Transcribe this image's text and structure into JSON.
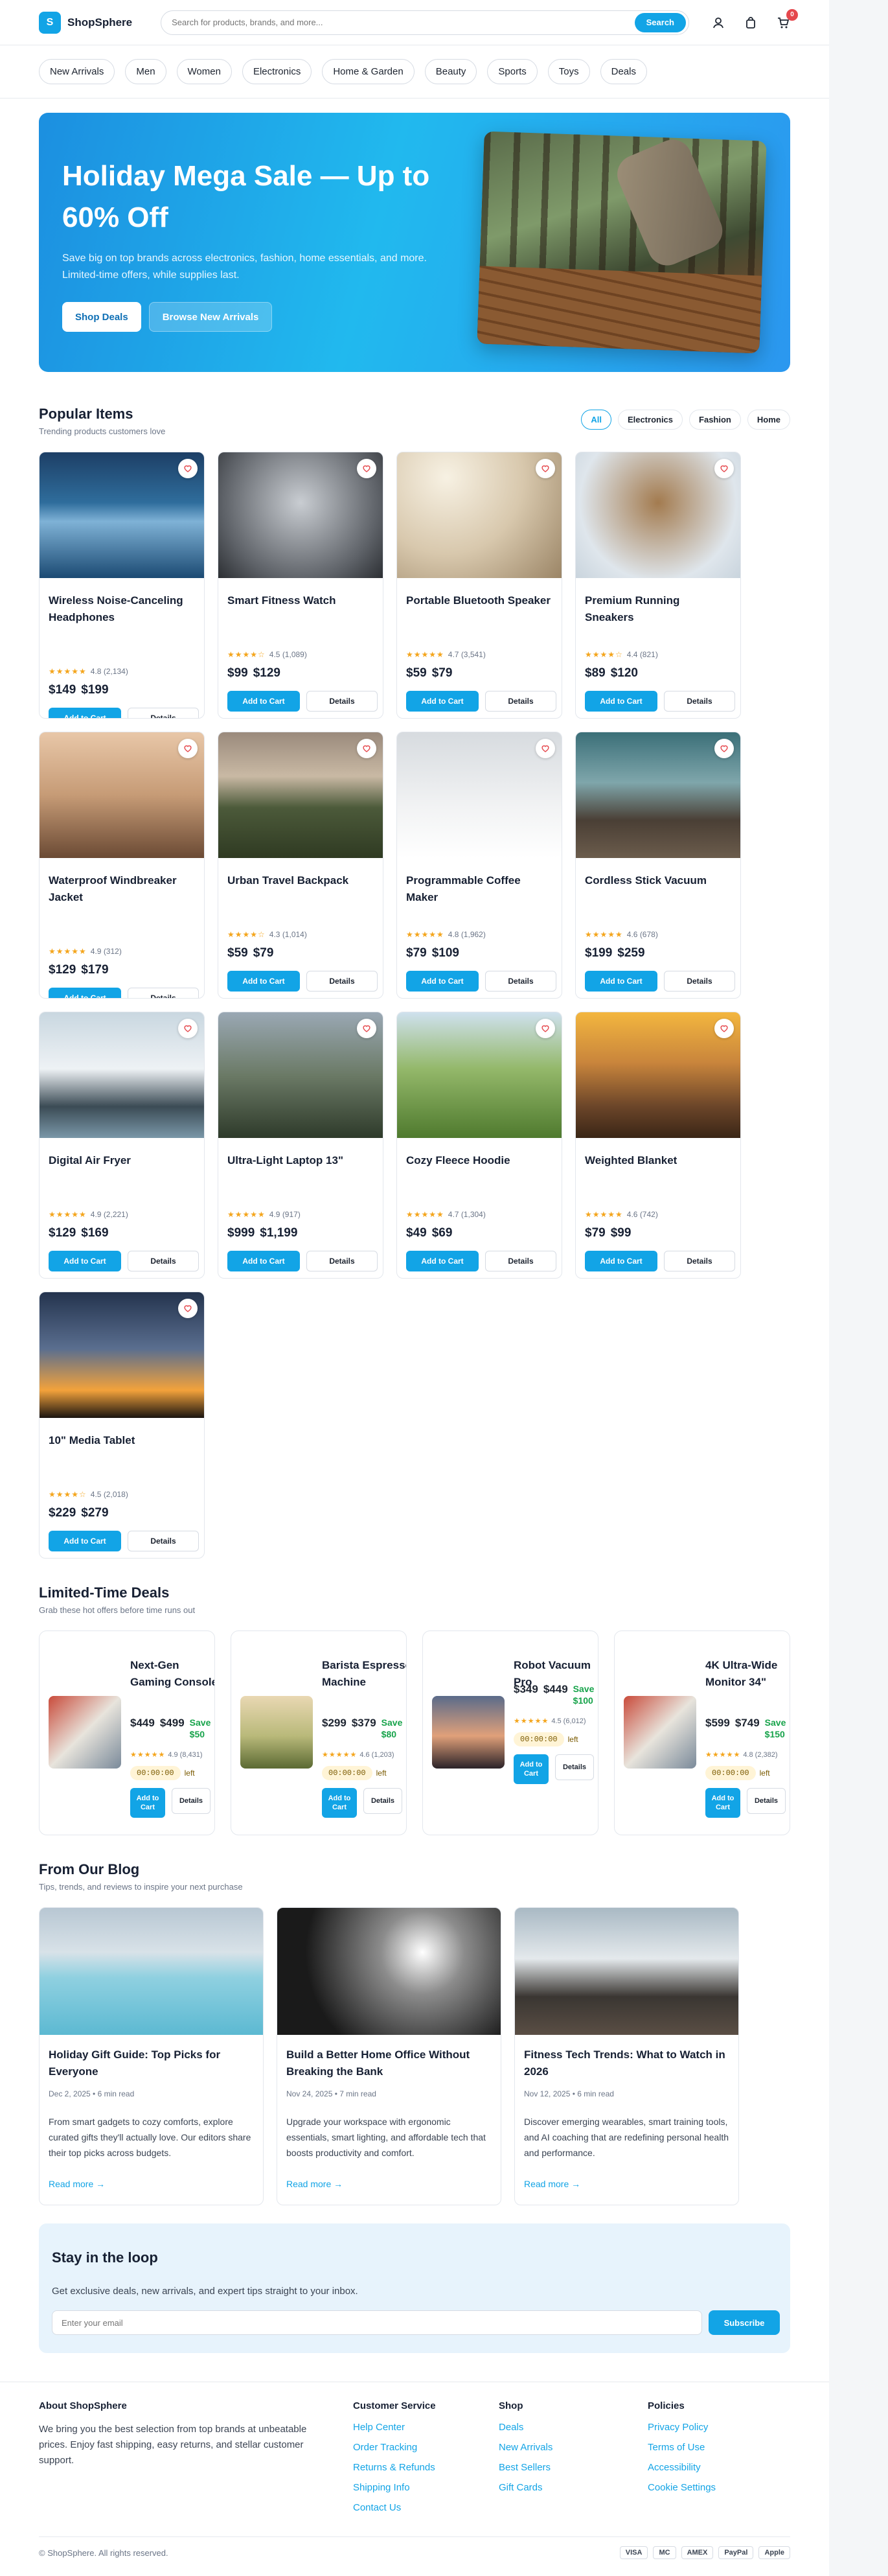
{
  "brand": {
    "name": "ShopSphere",
    "logo_glyph": "S"
  },
  "search": {
    "placeholder": "Search for products, brands, and more...",
    "button": "Search"
  },
  "cart": {
    "count": "0"
  },
  "nav": [
    "New Arrivals",
    "Men",
    "Women",
    "Electronics",
    "Home & Garden",
    "Beauty",
    "Sports",
    "Toys",
    "Deals"
  ],
  "hero": {
    "title": "Holiday Mega Sale — Up to 60% Off",
    "subtitle": "Save big on top brands across electronics, fashion, home essentials, and more. Limited-time offers, while supplies last.",
    "primary": "Shop Deals",
    "secondary": "Browse New Arrivals"
  },
  "popular": {
    "title": "Popular Items",
    "subtitle": "Trending products customers love",
    "filters": [
      "All",
      "Electronics",
      "Fashion",
      "Home"
    ]
  },
  "products": [
    {
      "name": "Wireless Noise-Canceling Headphones",
      "rating": "4.8 (2,134)",
      "stars": "★★★★★",
      "price": "$149",
      "old": "$199",
      "bg": "linear-gradient(180deg,#1d3f66,#2f6d9c 40%,#7fb2d6 55%,#1b4a73)"
    },
    {
      "name": "Smart Fitness Watch",
      "rating": "4.5 (1,089)",
      "stars": "★★★★☆",
      "price": "$99",
      "old": "$129",
      "bg": "radial-gradient(circle at 50% 40%,#c9cdd2,#5d6167 70%,#2c2f33)"
    },
    {
      "name": "Portable Bluetooth Speaker",
      "rating": "4.7 (3,541)",
      "stars": "★★★★★",
      "price": "$59",
      "old": "$79",
      "bg": "radial-gradient(circle at 30% 20%,#f7f1e3,#d8c8ad 50%,#9b8566)"
    },
    {
      "name": "Premium Running Sneakers",
      "rating": "4.4 (821)",
      "stars": "★★★★☆",
      "price": "$89",
      "old": "$120",
      "bg": "radial-gradient(circle at 50% 40%,#a37b4f,#dfe6ec 70%,#c9d4dd)"
    },
    {
      "name": "Waterproof Windbreaker Jacket",
      "rating": "4.9 (312)",
      "stars": "★★★★★",
      "price": "$129",
      "old": "$179",
      "bg": "linear-gradient(180deg,#e8c7a8,#c69b76 50%,#6b4a34)"
    },
    {
      "name": "Urban Travel Backpack",
      "rating": "4.3 (1,014)",
      "stars": "★★★★☆",
      "price": "$59",
      "old": "$79",
      "bg": "linear-gradient(180deg,#9a8a7c,#c9b9a4 35%,#4c5a3a 60%,#2f3a22)"
    },
    {
      "name": "Programmable Coffee Maker",
      "rating": "4.8 (1,962)",
      "stars": "★★★★★",
      "price": "$79",
      "old": "$109",
      "bg": "linear-gradient(180deg,#d7dbdf,#f2f3f4 60%,#ffffff)"
    },
    {
      "name": "Cordless Stick Vacuum",
      "rating": "4.6 (678)",
      "stars": "★★★★★",
      "price": "$199",
      "old": "$259",
      "bg": "linear-gradient(180deg,#3b6f78,#7fa6ab 40%,#4a3f35 70%,#6b5c4c)"
    },
    {
      "name": "Digital Air Fryer",
      "rating": "4.9 (2,221)",
      "stars": "★★★★★",
      "price": "$129",
      "old": "$169",
      "bg": "linear-gradient(180deg,#c9d7e0,#eef2f5 45%,#3b4b55 75%,#7a97a8)"
    },
    {
      "name": "Ultra-Light Laptop 13\"",
      "rating": "4.9 (917)",
      "stars": "★★★★★",
      "price": "$999",
      "old": "$1,199",
      "bg": "linear-gradient(180deg,#9aa8b4,#6b7a66 50%,#2e3a2a)"
    },
    {
      "name": "Cozy Fleece Hoodie",
      "rating": "4.7 (1,304)",
      "stars": "★★★★★",
      "price": "$49",
      "old": "$69",
      "bg": "linear-gradient(180deg,#cfe1ee,#94b86a 45%,#4f7a2e)"
    },
    {
      "name": "Weighted Blanket",
      "rating": "4.6 (742)",
      "stars": "★★★★★",
      "price": "$79",
      "old": "$99",
      "bg": "linear-gradient(180deg,#f3b63f,#c9853c 40%,#6b4529 75%,#3a2616)"
    },
    {
      "name": "10\" Media Tablet",
      "rating": "4.5 (2,018)",
      "stars": "★★★★☆",
      "price": "$229",
      "old": "$279",
      "bg": "linear-gradient(180deg,#24344e,#5a6e8f 45%,#f3a23b 78%,#1a1410)"
    }
  ],
  "buttons": {
    "add": "Add to Cart",
    "details": "Details"
  },
  "deals": {
    "title": "Limited-Time Deals",
    "subtitle": "Grab these hot offers before time runs out",
    "left": "left",
    "add": "Add to Cart",
    "items": [
      {
        "name": "Next-Gen Gaming Console",
        "price": "$449",
        "old": "$499",
        "save": "Save $50",
        "rating": "4.9 (8,431)",
        "timer": "00:00:00",
        "bg": "linear-gradient(135deg,#c94b3b,#e8e4dc 50%,#7a8a9a)"
      },
      {
        "name": "Barista Espresso Machine",
        "price": "$299",
        "old": "$379",
        "save": "Save $80",
        "rating": "4.6 (1,203)",
        "timer": "00:00:00",
        "bg": "linear-gradient(180deg,#e9d8b3,#b9b97a 55%,#5b6a33)"
      },
      {
        "name": "Robot Vacuum Pro",
        "price": "$349",
        "old": "$449",
        "save": "Save $100",
        "rating": "4.5 (6,012)",
        "timer": "00:00:00",
        "bg": "linear-gradient(180deg,#5a6b8a,#e0a07a 55%,#2a2228)"
      },
      {
        "name": "4K Ultra-Wide Monitor 34\"",
        "price": "$599",
        "old": "$749",
        "save": "Save $150",
        "rating": "4.8 (2,382)",
        "timer": "00:00:00",
        "bg": "linear-gradient(135deg,#c94b3b,#e8e4dc 50%,#7a8a9a)"
      }
    ]
  },
  "blog": {
    "title": "From Our Blog",
    "subtitle": "Tips, trends, and reviews to inspire your next purchase",
    "more": "Read more →",
    "posts": [
      {
        "title": "Holiday Gift Guide: Top Picks for Everyone",
        "meta": "Dec 2, 2025 • 6 min read",
        "excerpt": "From smart gadgets to cozy comforts, explore curated gifts they'll actually love. Our editors share their top picks across budgets.",
        "bg": "linear-gradient(180deg,#b8c7d3,#d8e2e8 35%,#8fd0e0 55%,#5cb9d2)"
      },
      {
        "title": "Build a Better Home Office Without Breaking the Bank",
        "meta": "Nov 24, 2025 • 7 min read",
        "excerpt": "Upgrade your workspace with ergonomic essentials, smart lighting, and affordable tech that boosts productivity and comfort.",
        "bg": "radial-gradient(circle at 65% 35%,#ffffff,#8c8c8c 25%,#1a1a1a 70%)"
      },
      {
        "title": "Fitness Tech Trends: What to Watch in 2026",
        "meta": "Nov 12, 2025 • 6 min read",
        "excerpt": "Discover emerging wearables, smart training tools, and AI coaching that are redefining personal health and performance.",
        "bg": "linear-gradient(180deg,#a9b9c4,#e4e9ec 40%,#3a3632 70%,#5a4e44)"
      }
    ]
  },
  "newsletter": {
    "title": "Stay in the loop",
    "subtitle": "Get exclusive deals, new arrivals, and expert tips straight to your inbox.",
    "placeholder": "Enter your email",
    "button": "Subscribe"
  },
  "footer": {
    "about_title": "About ShopSphere",
    "about": "We bring you the best selection from top brands at unbeatable prices. Enjoy fast shipping, easy returns, and stellar customer support.",
    "cols": [
      {
        "title": "Customer Service",
        "links": [
          "Help Center",
          "Order Tracking",
          "Returns & Refunds",
          "Shipping Info",
          "Contact Us"
        ]
      },
      {
        "title": "Shop",
        "links": [
          "Deals",
          "New Arrivals",
          "Best Sellers",
          "Gift Cards"
        ]
      },
      {
        "title": "Policies",
        "links": [
          "Privacy Policy",
          "Terms of Use",
          "Accessibility",
          "Cookie Settings"
        ]
      }
    ],
    "copyright": "© ShopSphere. All rights reserved.",
    "payments": [
      "VISA",
      "MC",
      "AMEX",
      "PayPal",
      "Apple"
    ]
  }
}
